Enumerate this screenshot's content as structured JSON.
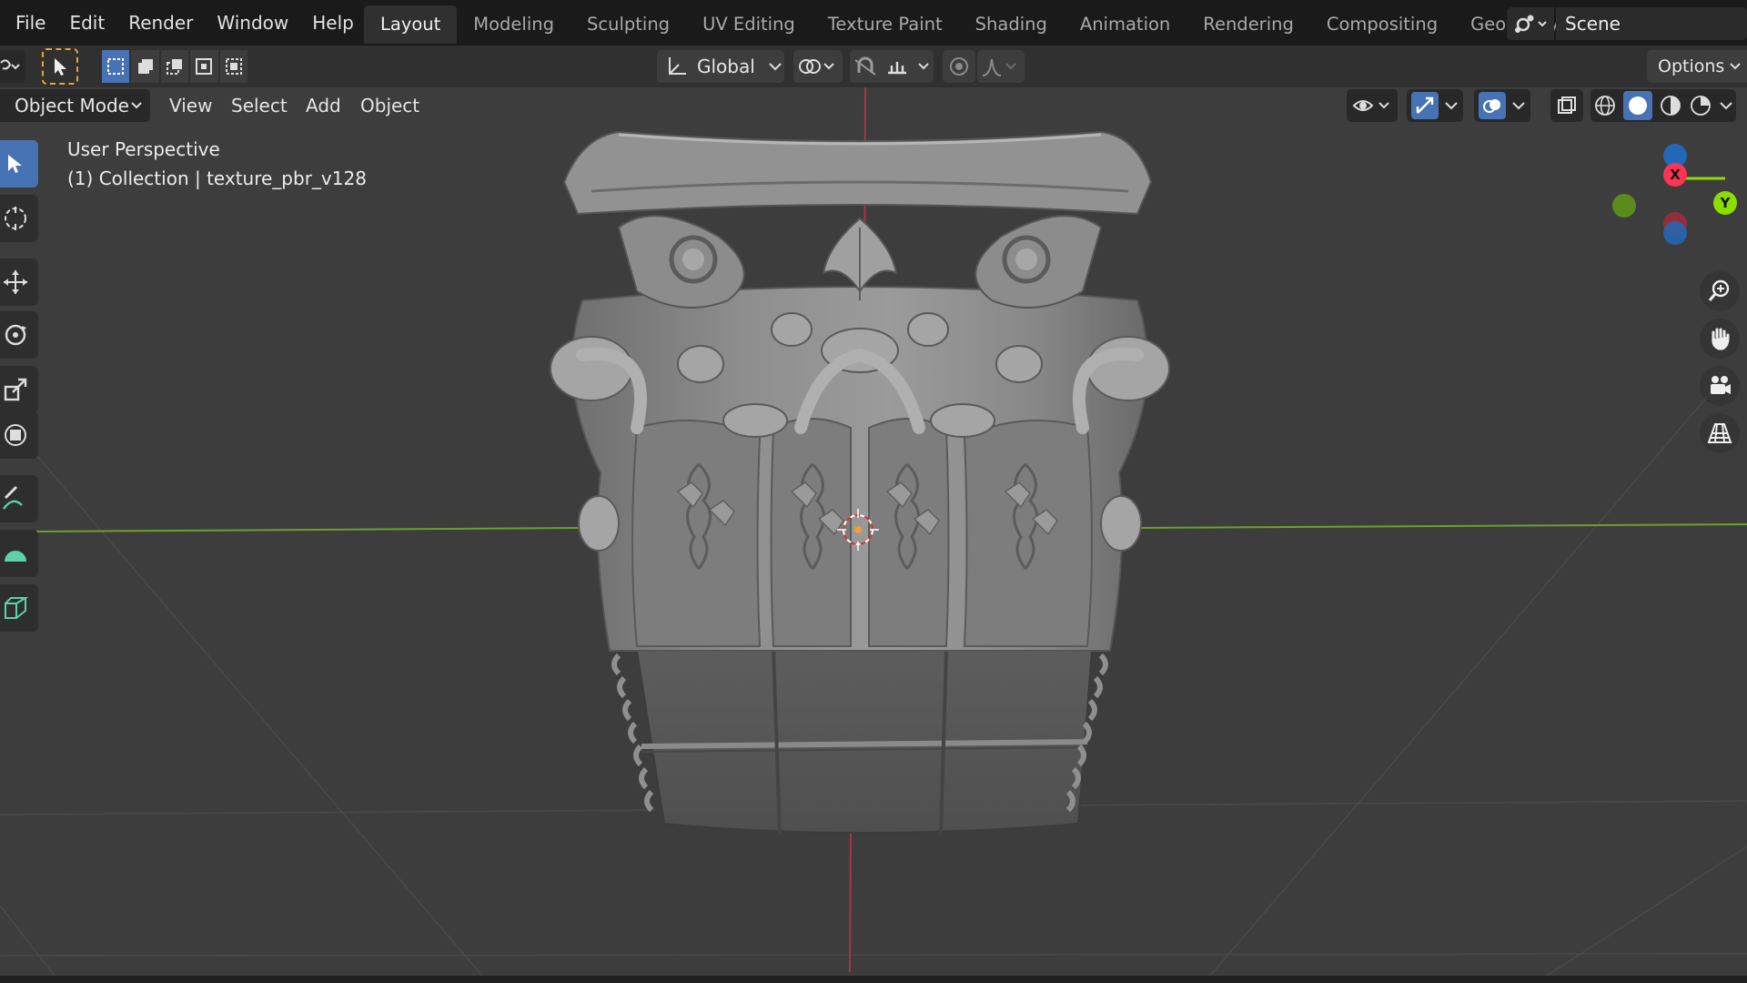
{
  "menu": {
    "items": [
      "File",
      "Edit",
      "Render",
      "Window",
      "Help"
    ]
  },
  "workspaces": [
    "Layout",
    "Modeling",
    "Sculpting",
    "UV Editing",
    "Texture Paint",
    "Shading",
    "Animation",
    "Rendering",
    "Compositing",
    "Geometry Nod"
  ],
  "scene": {
    "label": "Scene"
  },
  "toolbar": {
    "transform_orientation": "Global",
    "options_label": "Options"
  },
  "viewport_header": {
    "mode": "Object Mode",
    "menus": [
      "View",
      "Select",
      "Add",
      "Object"
    ]
  },
  "viewport": {
    "view_name": "User Perspective",
    "collection_info": "(1) Collection | texture_pbr_v128"
  },
  "gizmo": {
    "x_label": "X",
    "y_label": "Y"
  },
  "colors": {
    "accent": "#4772b3",
    "x_axis": "#ff3352",
    "y_axis": "#8bdc00",
    "z_axis": "#2890ff"
  }
}
